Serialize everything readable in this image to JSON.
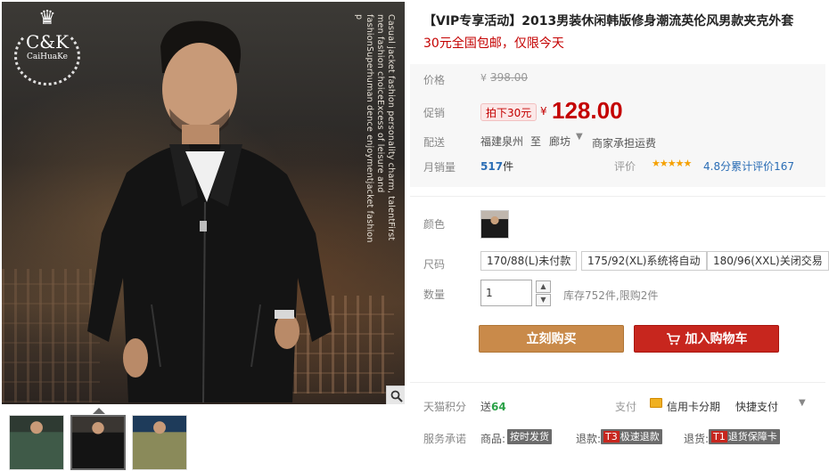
{
  "gallery": {
    "logo_main": "C&K",
    "logo_sub": "CaiHuaKe",
    "vertical_text": "Casual jacket fashion personality charm, talentFirst men fashion choiceExcess of leisure and fashionSuperhuman dence enjoymentjacket fashion p",
    "thumbnails": [
      "thumb-green-jacket",
      "thumb-black-jacket",
      "thumb-khaki-jacket"
    ],
    "active_thumb": 1
  },
  "product": {
    "title": "【VIP专享活动】2013男装休闲韩版修身潮流英伦风男款夹克外套",
    "subtitle": "30元全国包邮，仅限今天"
  },
  "price": {
    "orig_label": "价格",
    "currency": "¥",
    "orig_value": "398.00",
    "promo_label": "促销",
    "promo_tag": "拍下30元",
    "promo_value": "128.00"
  },
  "shipping": {
    "label": "配送",
    "from": "福建泉州",
    "to_word": "至",
    "dest": "廊坊",
    "fee": "商家承担运费"
  },
  "sales": {
    "label": "月销量",
    "count": "517",
    "unit": "件",
    "rating_label": "评价",
    "stars": "★★★★★",
    "rating_text": "4.8分累计评价167"
  },
  "sku": {
    "color_label": "颜色",
    "size_label": "尺码",
    "sizes": [
      "170/88(L)未付款",
      "175/92(XL)系统将自动",
      "180/96(XXL)关闭交易"
    ],
    "qty_label": "数量",
    "qty_value": "1",
    "stock": "库存752件,限购2件"
  },
  "actions": {
    "buy_now": "立刻购买",
    "add_cart": "加入购物车"
  },
  "points": {
    "label": "天猫积分",
    "prefix": "送",
    "value": "64",
    "pay_label": "支付",
    "card": "信用卡分期",
    "quickpay": "快捷支付"
  },
  "service": {
    "label": "服务承诺",
    "goods_word": "商品:",
    "goods_tag": "按时发货",
    "refund_word": "退款:",
    "refund_t": "T3",
    "refund_tag": "极速退款",
    "return_word": "退货:",
    "return_t": "T1",
    "return_tag": "退货保障卡"
  },
  "colors": {
    "accent_red": "#c40000",
    "buy_now": "#c98a4a",
    "add_cart": "#c7261e"
  }
}
